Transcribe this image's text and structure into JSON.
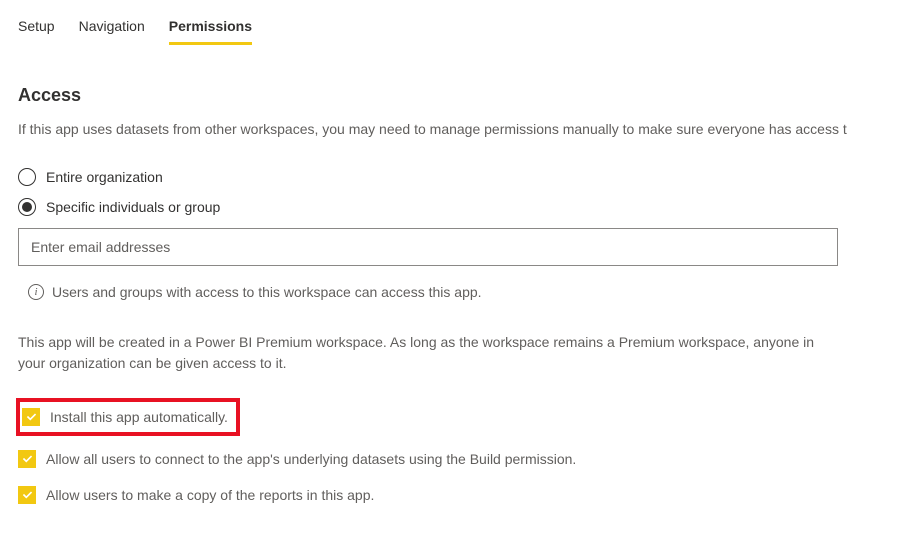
{
  "tabs": {
    "setup": "Setup",
    "navigation": "Navigation",
    "permissions": "Permissions"
  },
  "section": {
    "title": "Access",
    "description": "If this app uses datasets from other workspaces, you may need to manage permissions manually to make sure everyone has access t"
  },
  "radio": {
    "entire_org": "Entire organization",
    "specific": "Specific individuals or group"
  },
  "email": {
    "placeholder": "Enter email addresses"
  },
  "info": {
    "text": "Users and groups with access to this workspace can access this app."
  },
  "premium": {
    "text": "This app will be created in a Power BI Premium workspace. As long as the workspace remains a Premium workspace, anyone in your organization can be given access to it."
  },
  "checkboxes": {
    "install_auto": "Install this app automatically.",
    "allow_build": "Allow all users to connect to the app's underlying datasets using the Build permission.",
    "allow_copy": "Allow users to make a copy of the reports in this app."
  }
}
